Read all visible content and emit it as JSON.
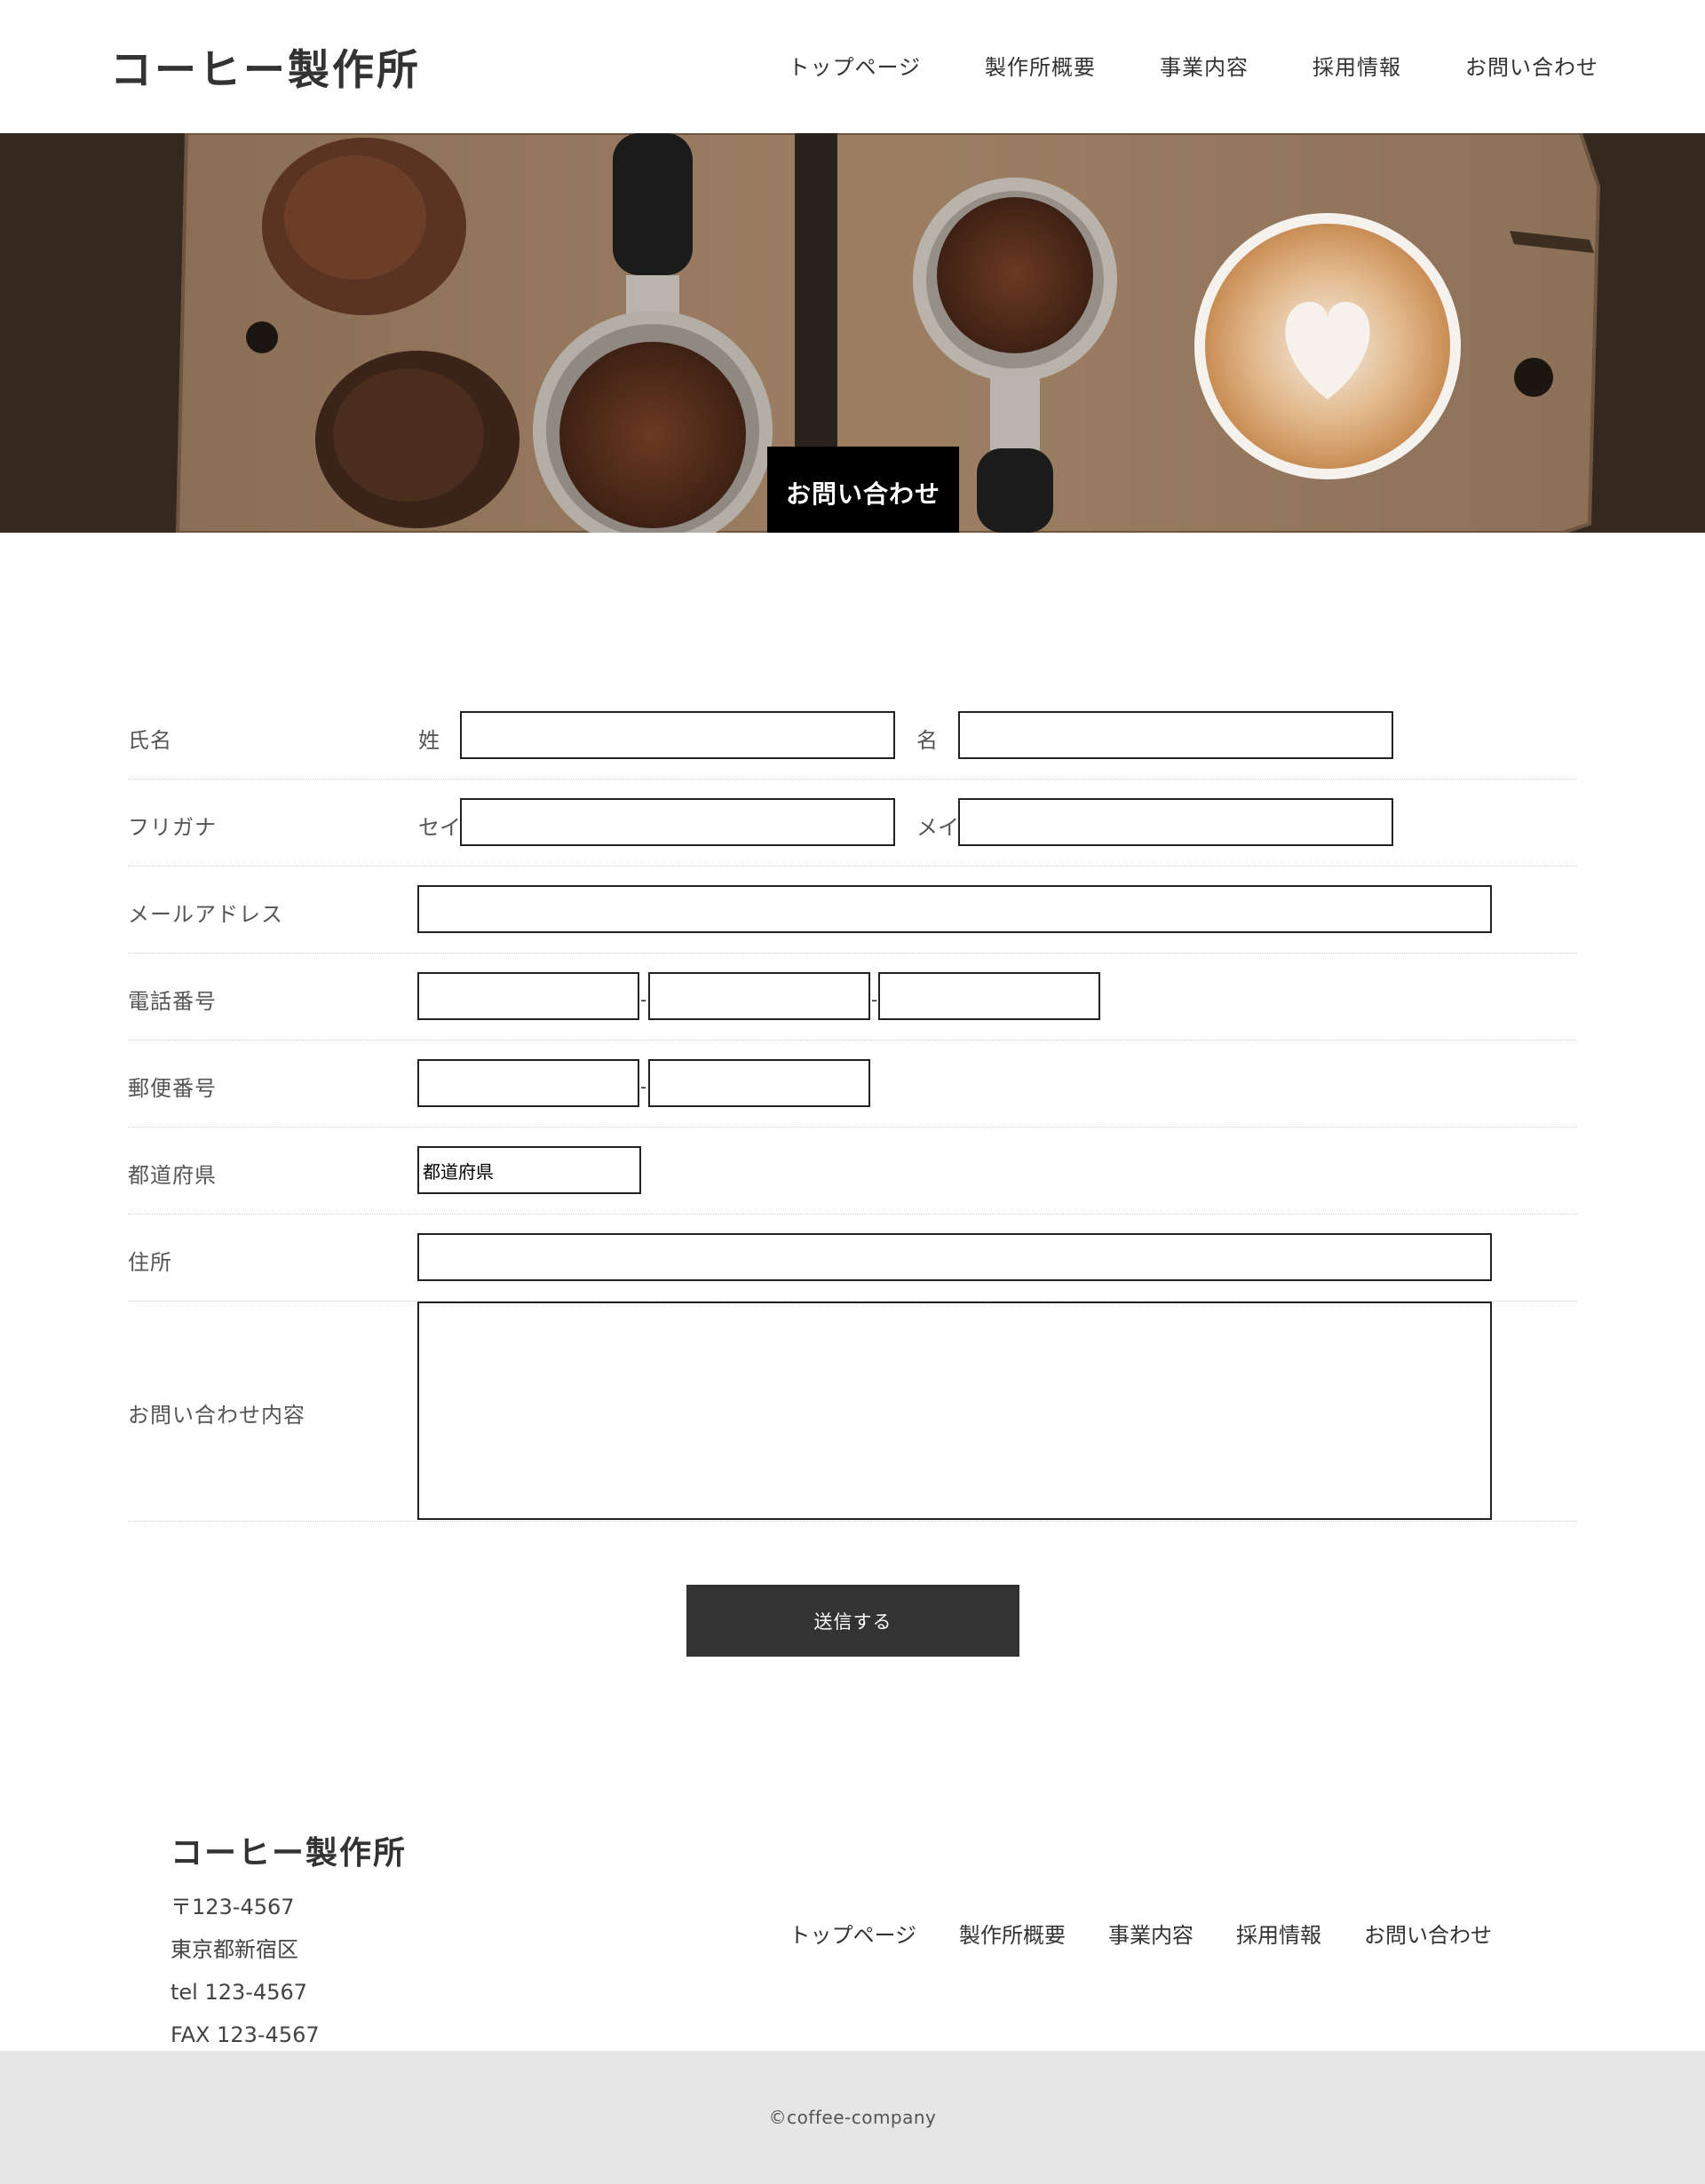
{
  "header": {
    "logo": "コーヒー製作所",
    "nav": [
      "トップページ",
      "製作所概要",
      "事業内容",
      "採用情報",
      "お問い合わせ"
    ]
  },
  "hero": {
    "title": "お問い合わせ"
  },
  "form": {
    "name": {
      "label": "氏名",
      "last_label": "姓",
      "first_label": "名"
    },
    "kana": {
      "label": "フリガナ",
      "last_label": "セイ",
      "first_label": "メイ"
    },
    "email": {
      "label": "メールアドレス"
    },
    "phone": {
      "label": "電話番号",
      "separator": "-"
    },
    "postal": {
      "label": "郵便番号",
      "separator": "-"
    },
    "prefecture": {
      "label": "都道府県",
      "selected": "都道府県"
    },
    "address": {
      "label": "住所"
    },
    "message": {
      "label": "お問い合わせ内容"
    },
    "submit_label": "送信する"
  },
  "footer": {
    "logo": "コーヒー製作所",
    "address_lines": [
      "〒123-4567",
      "東京都新宿区",
      "tel 123-4567",
      "FAX 123-4567"
    ],
    "nav": [
      "トップページ",
      "製作所概要",
      "事業内容",
      "採用情報",
      "お問い合わせ"
    ],
    "copyright": "©coffee-company"
  }
}
